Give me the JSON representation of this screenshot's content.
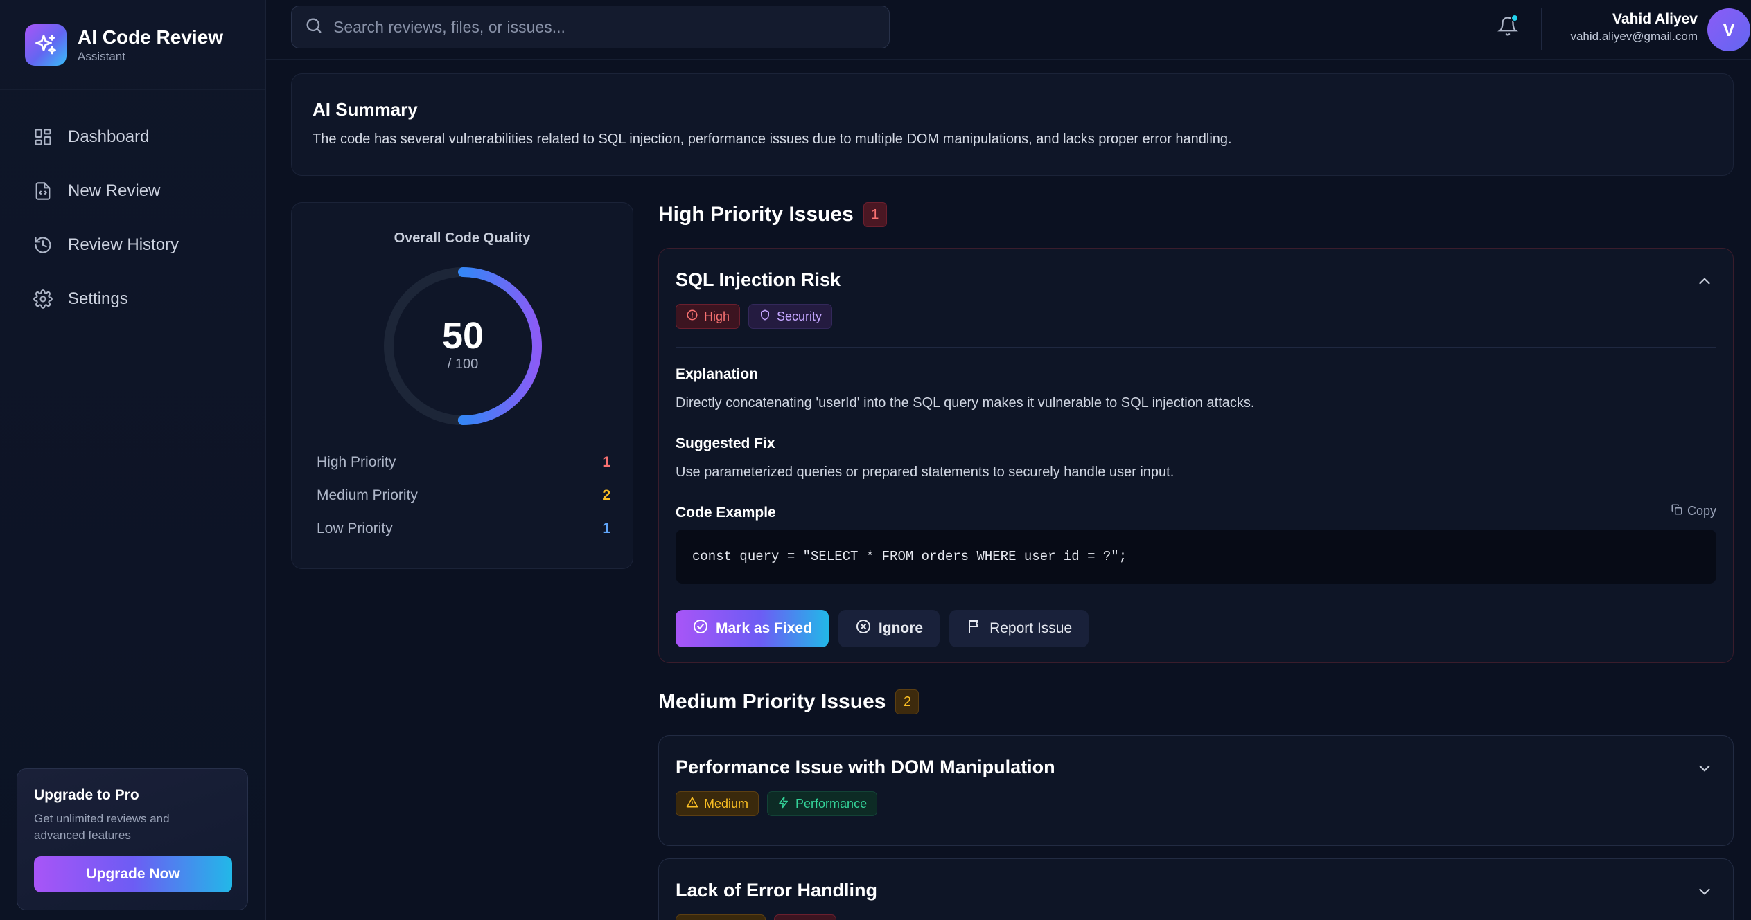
{
  "brand": {
    "title": "AI Code Review",
    "subtitle": "Assistant"
  },
  "sidebar": {
    "items": [
      {
        "label": "Dashboard",
        "icon": "dashboard-icon"
      },
      {
        "label": "New Review",
        "icon": "file-code-icon"
      },
      {
        "label": "Review History",
        "icon": "history-icon"
      },
      {
        "label": "Settings",
        "icon": "gear-icon"
      }
    ],
    "upgrade": {
      "title": "Upgrade to Pro",
      "description": "Get unlimited reviews and advanced features",
      "button": "Upgrade Now"
    }
  },
  "header": {
    "search_placeholder": "Search reviews, files, or issues...",
    "notification_dot": true,
    "user": {
      "name": "Vahid Aliyev",
      "email": "vahid.aliyev@gmail.com",
      "initial": "V"
    }
  },
  "summary": {
    "title": "AI Summary",
    "text": "The code has several vulnerabilities related to SQL injection, performance issues due to multiple DOM manipulations, and lacks proper error handling."
  },
  "quality": {
    "title": "Overall Code Quality",
    "score": "50",
    "score_value": 50,
    "out_of": "/ 100",
    "rows": [
      {
        "label": "High Priority",
        "value": "1",
        "color": "#f87171"
      },
      {
        "label": "Medium Priority",
        "value": "2",
        "color": "#fbbf24"
      },
      {
        "label": "Low Priority",
        "value": "1",
        "color": "#60a5fa"
      }
    ]
  },
  "high": {
    "title": "High Priority Issues",
    "count": "1",
    "issue": {
      "title": "SQL Injection Risk",
      "tags": [
        "High",
        "Security"
      ],
      "explanation_label": "Explanation",
      "explanation": "Directly concatenating 'userId' into the SQL query makes it vulnerable to SQL injection attacks.",
      "fix_label": "Suggested Fix",
      "fix": "Use parameterized queries or prepared statements to securely handle user input.",
      "code_label": "Code Example",
      "copy_label": "Copy",
      "code": "const query = \"SELECT * FROM orders WHERE user_id = ?\";",
      "actions": {
        "fixed": "Mark as Fixed",
        "ignore": "Ignore",
        "report": "Report Issue"
      }
    }
  },
  "medium": {
    "title": "Medium Priority Issues",
    "count": "2",
    "issues": [
      {
        "title": "Performance Issue with DOM Manipulation",
        "tags": [
          "Medium",
          "Performance"
        ]
      },
      {
        "title": "Lack of Error Handling"
      }
    ]
  },
  "colors": {
    "accent_purple": "#a855f7",
    "accent_cyan": "#22b8e8",
    "background": "#0b1121"
  }
}
